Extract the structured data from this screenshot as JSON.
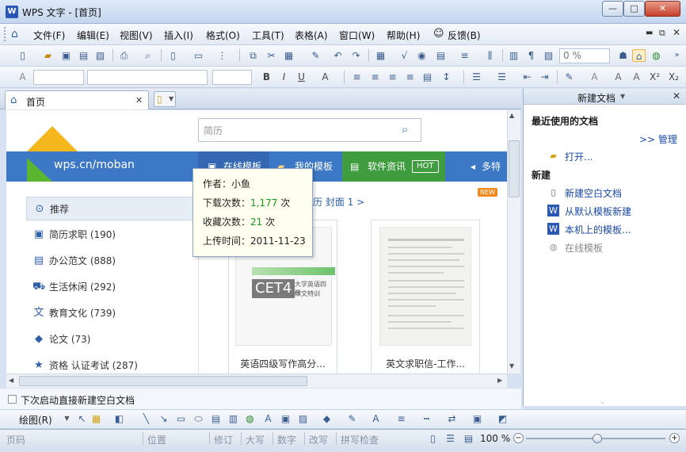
{
  "window": {
    "title": "WPS 文字 - [首页]",
    "app_icon_label": "W",
    "minimize": "—",
    "maximize": "□",
    "close": "✕"
  },
  "menus": [
    "文件(F)",
    "编辑(E)",
    "视图(V)",
    "插入(I)",
    "格式(O)",
    "工具(T)",
    "表格(A)",
    "窗口(W)",
    "帮助(H)",
    "反馈(B)"
  ],
  "toolbar": {
    "zoom_value": "0 %"
  },
  "tabs": {
    "home_label": "首页",
    "close": "✕"
  },
  "search": {
    "placeholder": "简历"
  },
  "site": {
    "logo_url_text": "wps.cn/moban",
    "nav": [
      "在线模板",
      "我的模板",
      "软件资讯",
      "多特"
    ],
    "hot_badge": "HOT",
    "new_badge": "NEW",
    "filter_text": "历  封面  1 >"
  },
  "categories": [
    {
      "label": "推荐",
      "icon": "circle-icon"
    },
    {
      "label": "简历求职 (190)",
      "icon": "resume-icon"
    },
    {
      "label": "办公范文 (888)",
      "icon": "document-icon"
    },
    {
      "label": "生活休闲 (292)",
      "icon": "cart-icon"
    },
    {
      "label": "教育文化 (739)",
      "icon": "text-icon"
    },
    {
      "label": "论文 (73)",
      "icon": "graduation-cap-icon"
    },
    {
      "label": "资格 认证考试 (287)",
      "icon": "certificate-icon"
    }
  ],
  "cards": [
    {
      "title": "英语四级写作高分...",
      "thumb_title": "CET4",
      "thumb_sub1": "大学英语四级",
      "thumb_sub2": "作文特训"
    },
    {
      "title": "英文求职信-工作..."
    }
  ],
  "tooltip": {
    "author": "作者：小鱼",
    "downloads_label": "下载次数：",
    "downloads_value": "1,177",
    "downloads_unit": " 次",
    "favorites_label": "收藏次数：",
    "favorites_value": "21",
    "favorites_unit": " 次",
    "upload_time": "上传时间：2011-11-23"
  },
  "startup_checkbox": "下次启动直接新建空白文档",
  "right_panel": {
    "header": "新建文档",
    "recent_title": "最近使用的文档",
    "manage": ">> 管理",
    "open": "打开...",
    "new_title": "新建",
    "new_blank": "新建空白文档",
    "from_default": "从默认模板新建",
    "local_templates": "本机上的模板...",
    "online_templates": "在线模板"
  },
  "draw_toolbar": {
    "draw_label": "绘图(R)"
  },
  "statusbar": {
    "page": "页码",
    "position": "位置",
    "revise": "修订",
    "caps": "大写",
    "num": "数字",
    "overwrite": "改写",
    "spell": "拼写检查",
    "zoom": "100 %"
  },
  "colors": {
    "brand_blue": "#3c78c5",
    "green_nav": "#3f9d3f",
    "link_blue": "#1b49a8",
    "download_green": "#1a9a1a"
  }
}
